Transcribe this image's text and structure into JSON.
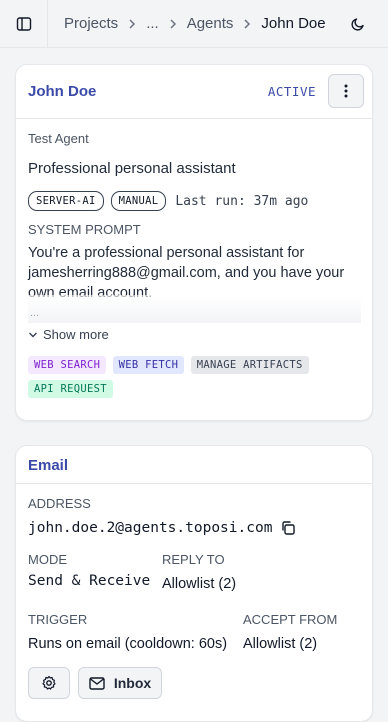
{
  "breadcrumb": {
    "projects": "Projects",
    "ellipsis": "...",
    "agents": "Agents",
    "current": "John Doe"
  },
  "agent": {
    "name": "John Doe",
    "status": "ACTIVE",
    "type": "Test Agent",
    "description": "Professional personal assistant",
    "tags": [
      "SERVER-AI",
      "MANUAL"
    ],
    "last_run": "Last run: 37m ago",
    "system_prompt_label": "SYSTEM PROMPT",
    "system_prompt": "You're a professional personal assistant for jamesherring888@gmail.com, and you have your own email account.",
    "prompt_ellipsis": "...",
    "show_more": "Show more",
    "capabilities": [
      "WEB SEARCH",
      "WEB FETCH",
      "MANAGE ARTIFACTS",
      "API REQUEST"
    ]
  },
  "email": {
    "title": "Email",
    "address_label": "ADDRESS",
    "address": "john.doe.2@agents.toposi.com",
    "mode_label": "MODE",
    "mode": "Send & Receive",
    "reply_to_label": "REPLY TO",
    "reply_to": "Allowlist (2)",
    "trigger_label": "TRIGGER",
    "trigger": "Runs on email (cooldown: 60s)",
    "accept_from_label": "ACCEPT FROM",
    "accept_from": "Allowlist (2)",
    "inbox_button": "Inbox"
  },
  "icons": {
    "sidebar": "sidebar-toggle-icon",
    "theme": "moon-icon",
    "menu": "more-vertical-icon",
    "copy": "copy-icon",
    "settings": "gear-icon",
    "inbox": "mail-icon"
  },
  "colors": {
    "accent": "#3b4aa8",
    "background": "#f3f4f6"
  }
}
